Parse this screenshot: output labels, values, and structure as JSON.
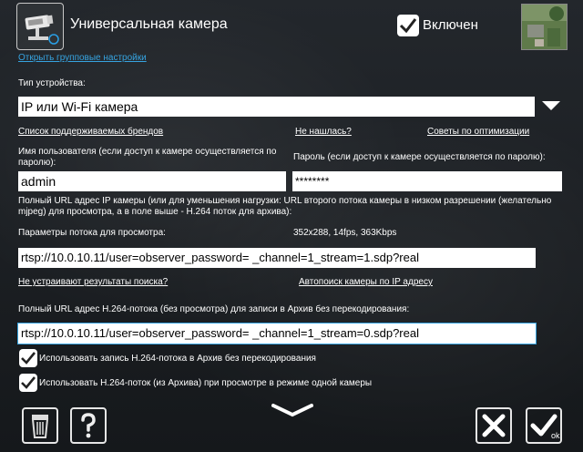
{
  "header": {
    "title": "Универсальная камера",
    "groups_link": "Открыть групповые настройки",
    "enabled_label": "Включен",
    "enabled_checked": true
  },
  "device_type": {
    "label": "Тип устройства:",
    "value": "IP или Wi-Fi камера"
  },
  "links": {
    "brands": "Список поддерживаемых брендов",
    "not_found": "Не нашлась?",
    "optimization": "Советы по оптимизации",
    "bad_results": "Не устраивают результаты поиска?",
    "auto_search": "Автопоиск камеры по IP адресу"
  },
  "credentials": {
    "user_label": "Имя пользователя (если доступ к камере осуществляется по паролю):",
    "user_value": "admin",
    "pass_label": "Пароль (если доступ к камере осуществляется по паролю):",
    "pass_value": "********"
  },
  "stream": {
    "url_desc": "Полный URL адрес IP камеры (или для уменьшения нагрузки: URL второго потока камеры в низком разрешении (желательно mjpeg) для просмотра, а в поле выше - H.264 поток для архива):",
    "params_label": "Параметры потока для просмотра:",
    "params_value": "352x288, 14fps, 363Kbps",
    "url_value": "rtsp://10.0.10.11/user=observer_password=                        _channel=1_stream=1.sdp?real",
    "h264_desc": "Полный URL адрес H.264-потока (без просмотра) для записи в Архив без перекодирования:",
    "h264_value": "rtsp://10.0.10.11/user=observer_password=                        _channel=1_stream=0.sdp?real"
  },
  "options": [
    {
      "label": "Использовать запись H.264-потока в Архив без перекодирования",
      "checked": true
    },
    {
      "label": "Использовать H.264-поток (из Архива) при просмотре в режиме одной камеры",
      "checked": true
    }
  ],
  "footer": {
    "ok_label": "ok"
  }
}
